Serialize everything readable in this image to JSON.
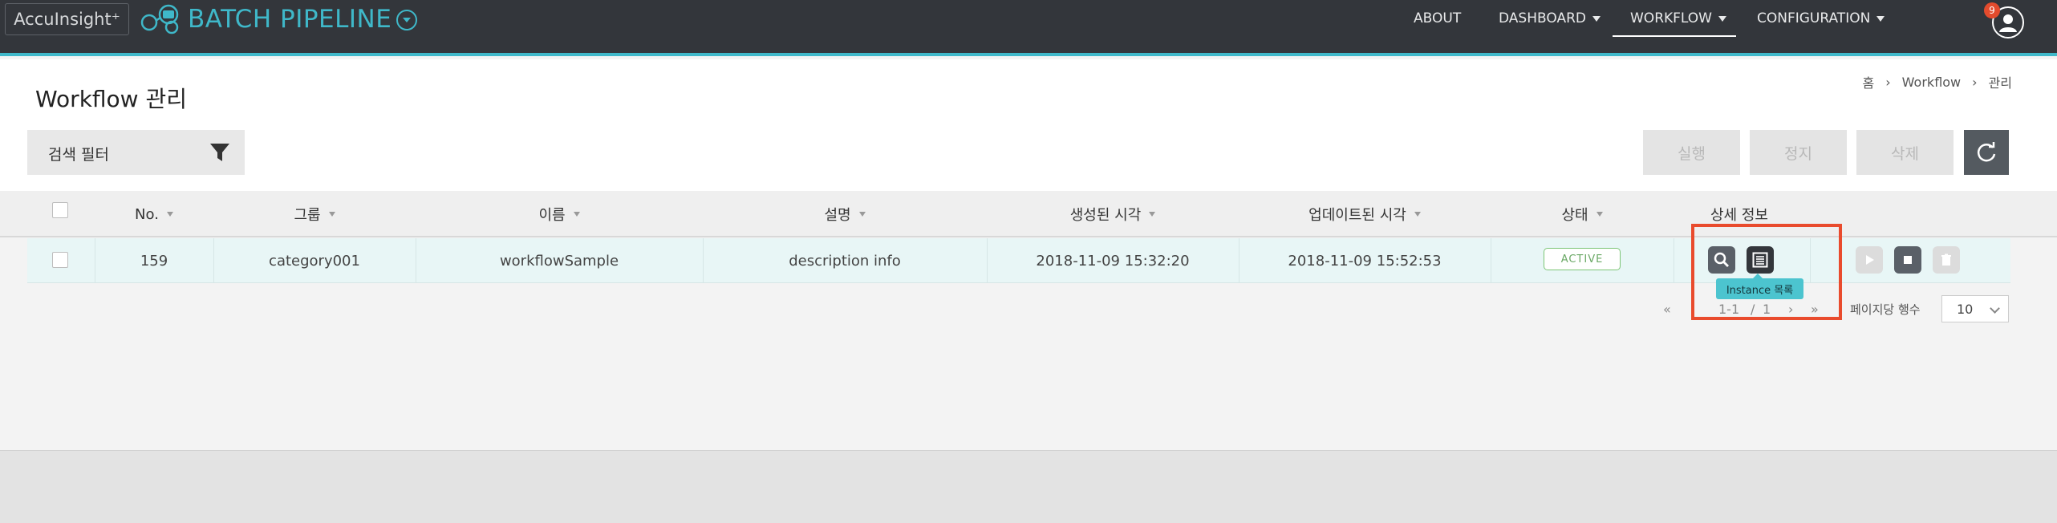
{
  "app": {
    "brand_box": "AccuInsight⁺",
    "product": "BATCH PIPELINE"
  },
  "nav": {
    "items": [
      {
        "label": "ABOUT"
      },
      {
        "label": "DASHBOARD"
      },
      {
        "label": "WORKFLOW"
      },
      {
        "label": "CONFIGURATION"
      }
    ],
    "active": "WORKFLOW",
    "notification_count": "9"
  },
  "page": {
    "title": "Workflow 관리",
    "breadcrumb": [
      "홈",
      "Workflow",
      "관리"
    ]
  },
  "toolbar": {
    "filter_label": "검색 필터",
    "run_label": "실행",
    "stop_label": "정지",
    "delete_label": "삭제"
  },
  "table": {
    "columns": [
      "No.",
      "그룹",
      "이름",
      "설명",
      "생성된 시각",
      "업데이트된 시각",
      "상태",
      "상세 정보"
    ],
    "rows": [
      {
        "no": "159",
        "group": "category001",
        "name": "workflowSample",
        "description": "description info",
        "created": "2018-11-09 15:32:20",
        "updated": "2018-11-09 15:52:53",
        "status": "ACTIVE"
      }
    ],
    "tooltip": "Instance 목록"
  },
  "pagination": {
    "range": "1-1",
    "separator": "/",
    "total_pages": "1",
    "rows_per_page_label": "페이지당 행수",
    "rows_per_page": "10"
  },
  "colors": {
    "topbar": "#33363b",
    "accent": "#3fb8c9",
    "status_active": "#7cc576",
    "highlight": "#e94b2d"
  }
}
